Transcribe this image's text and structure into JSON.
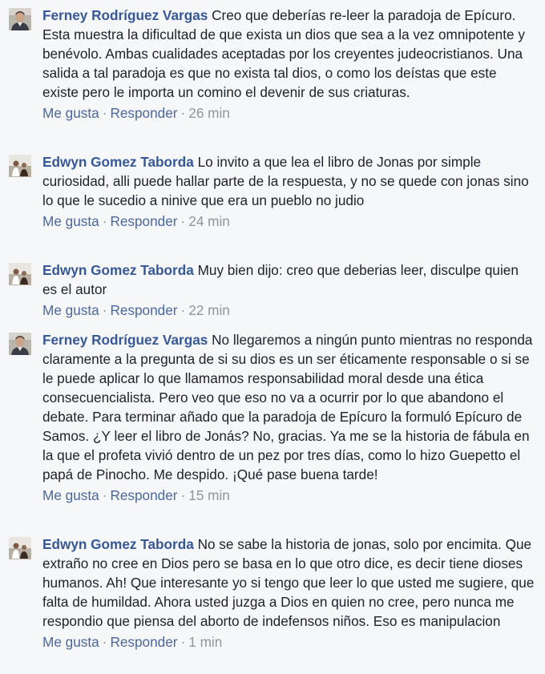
{
  "actions": {
    "like": "Me gusta",
    "reply": "Responder",
    "separator": "·"
  },
  "colors": {
    "author": "#365899",
    "link": "#4b67a1",
    "meta": "#90949c",
    "text": "#1d2129",
    "background": "#f6f7f9"
  },
  "comments": [
    {
      "author": "Ferney Rodríguez Vargas",
      "avatar": "avatar-icon",
      "text": "Creo que deberías re-leer la paradoja de Epícuro. Esta muestra la dificultad de que exista un dios que sea a la vez omnipotente y benévolo. Ambas cualidades aceptadas por los creyentes judeocristianos. Una salida a tal paradoja es que no exista tal dios, o como los deístas que este existe pero le importa un comino el devenir de sus criaturas.",
      "time": "26 min"
    },
    {
      "author": "Edwyn Gomez Taborda",
      "avatar": "avatar-icon",
      "text": "Lo invito a que lea el libro de Jonas por simple curiosidad, alli puede hallar parte de la respuesta, y no se quede con jonas sino lo que le sucedio a ninive que era un pueblo no judio",
      "time": "24 min"
    },
    {
      "author": "Edwyn Gomez Taborda",
      "avatar": "avatar-icon",
      "text": "Muy bien dijo: creo que deberias leer, disculpe quien es el autor",
      "time": "22 min"
    },
    {
      "author": "Ferney Rodríguez Vargas",
      "avatar": "avatar-icon",
      "text": "No llegaremos a ningún punto mientras no responda claramente a la pregunta de si su dios es un ser éticamente responsable o si se le puede aplicar lo que llamamos responsabilidad moral desde una ética consecuencialista. Pero veo que eso no va a ocurrir por lo que abandono el debate. Para terminar añado que la paradoja de Epícuro la formuló Epícuro de Samos. ¿Y leer el libro de Jonás? No, gracias. Ya me se la historia de fábula en la que el profeta vivió dentro de un pez por tres días, como lo hizo Guepetto el papá de Pinocho. Me despido. ¡Qué pase buena tarde!",
      "time": "15 min"
    },
    {
      "author": "Edwyn Gomez Taborda",
      "avatar": "avatar-icon",
      "text": "No se sabe la historia de jonas, solo por encimita. Que extraño no cree en Dios pero se basa en lo que otro dice, es decir tiene dioses humanos. Ah! Que interesante yo si tengo que leer lo que usted me sugiere, que falta de humildad. Ahora usted juzga a Dios en quien no cree, pero nunca me respondio que piensa del aborto de indefensos niños. Eso es manipulacion",
      "time": "1 min"
    }
  ]
}
